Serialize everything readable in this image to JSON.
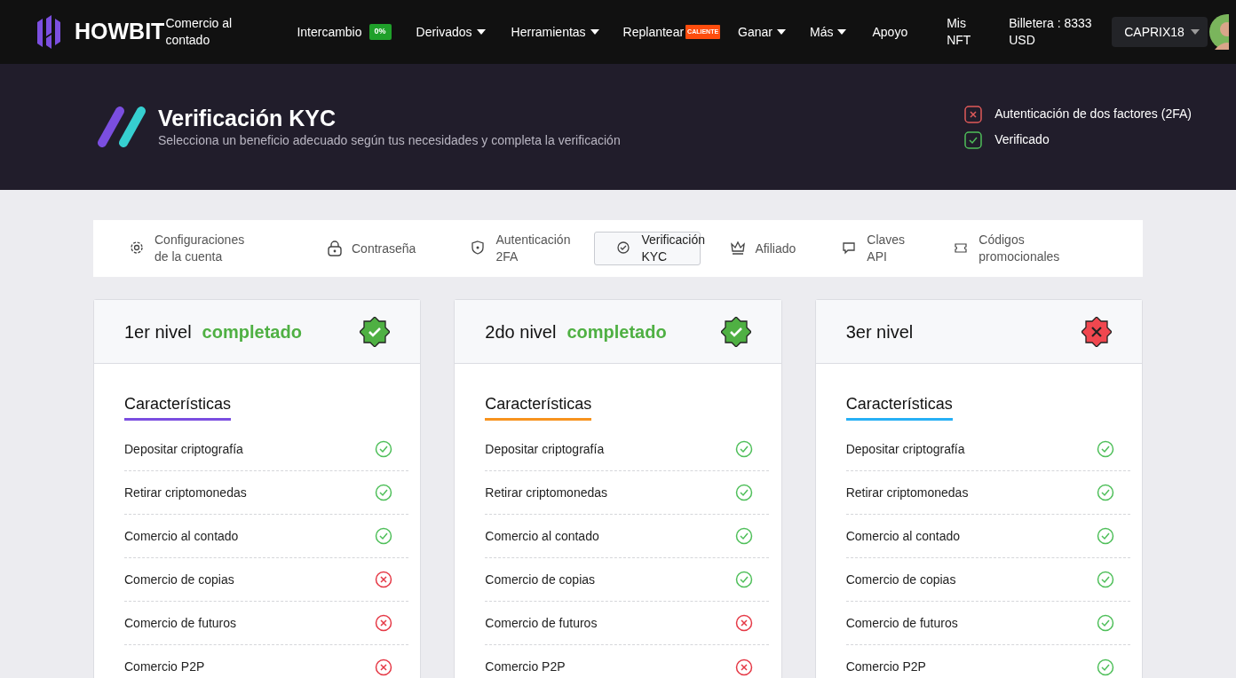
{
  "navbar": {
    "brand": "HOWBIT",
    "brand_subtitle": "Comercio al contado",
    "items": [
      {
        "label": "Intercambio",
        "badge": "0%",
        "kind": "fee",
        "dropdown": false
      },
      {
        "label": "Derivados",
        "dropdown": true
      },
      {
        "label": "Herramientas",
        "dropdown": true
      },
      {
        "label": "Replantear",
        "badge": "CALIENTE",
        "kind": "hot",
        "dropdown": false
      },
      {
        "label": "Ganar",
        "dropdown": true
      },
      {
        "label": "Más",
        "dropdown": true
      },
      {
        "label": "Apoyo",
        "dropdown": false
      },
      {
        "label": "Mis NFT",
        "dropdown": false
      }
    ],
    "wallet": "Billetera : 8333 USD",
    "user": "CAPRIX18"
  },
  "banner": {
    "title": "Verificación KYC",
    "subtitle": "Selecciona un beneficio adecuado según tus necesidades y completa la verificación",
    "status": [
      {
        "label": "Autenticación de dos factores (2FA)",
        "ok": false
      },
      {
        "label": "Verificado",
        "ok": true
      }
    ]
  },
  "tabs": [
    {
      "label": "Configuraciones de la cuenta",
      "selected": false
    },
    {
      "label": "Contraseña",
      "selected": false
    },
    {
      "label": "Autenticación 2FA",
      "selected": false
    },
    {
      "label": "Verificación KYC",
      "selected": true
    },
    {
      "label": "Afiliado",
      "selected": false
    },
    {
      "label": "Claves API",
      "selected": false
    },
    {
      "label": "Códigos promocionales",
      "selected": false
    }
  ],
  "levels": [
    {
      "title": "1er nivel",
      "status": "completado",
      "completed": true,
      "heading": "Características",
      "color": "#7b4ee0",
      "features": [
        {
          "label": "Depositar criptografía",
          "enabled": true
        },
        {
          "label": "Retirar criptomonedas",
          "enabled": true
        },
        {
          "label": "Comercio al contado",
          "enabled": true
        },
        {
          "label": "Comercio de copias",
          "enabled": false
        },
        {
          "label": "Comercio de futuros",
          "enabled": false
        },
        {
          "label": "Comercio P2P",
          "enabled": false
        }
      ]
    },
    {
      "title": "2do nivel",
      "status": "completado",
      "completed": true,
      "heading": "Características",
      "color": "#f7931e",
      "features": [
        {
          "label": "Depositar criptografía",
          "enabled": true
        },
        {
          "label": "Retirar criptomonedas",
          "enabled": true
        },
        {
          "label": "Comercio al contado",
          "enabled": true
        },
        {
          "label": "Comercio de copias",
          "enabled": true
        },
        {
          "label": "Comercio de futuros",
          "enabled": false
        },
        {
          "label": "Comercio P2P",
          "enabled": false
        }
      ]
    },
    {
      "title": "3er nivel",
      "completed": false,
      "heading": "Características",
      "color": "#27b0f5",
      "features": [
        {
          "label": "Depositar criptografía",
          "enabled": true
        },
        {
          "label": "Retirar criptomonedas",
          "enabled": true
        },
        {
          "label": "Comercio al contado",
          "enabled": true
        },
        {
          "label": "Comercio de copias",
          "enabled": true
        },
        {
          "label": "Comercio de futuros",
          "enabled": true
        },
        {
          "label": "Comercio P2P",
          "enabled": true
        }
      ]
    }
  ]
}
